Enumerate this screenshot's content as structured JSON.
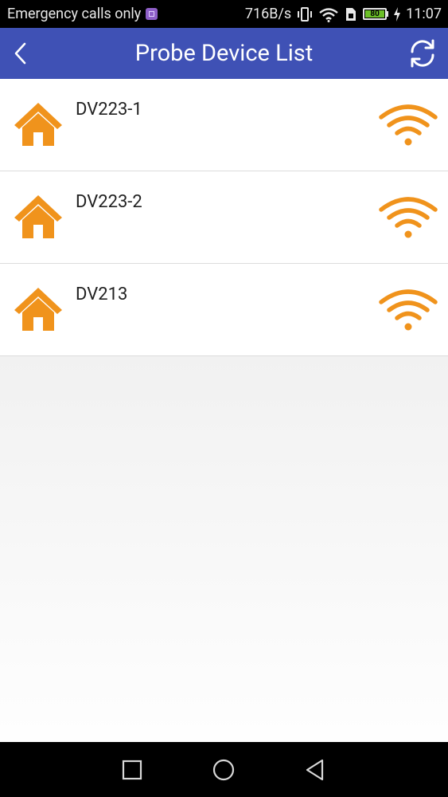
{
  "status_bar": {
    "carrier_text": "Emergency calls only",
    "network_speed": "716B/s",
    "battery_level": "80",
    "time": "11:07"
  },
  "header": {
    "title": "Probe Device List",
    "back_icon": "chevron-left-icon",
    "refresh_icon": "refresh-icon"
  },
  "devices": [
    {
      "name": "DV223-1",
      "icon": "home-icon",
      "signal_icon": "wifi-icon"
    },
    {
      "name": "DV223-2",
      "icon": "home-icon",
      "signal_icon": "wifi-icon"
    },
    {
      "name": "DV213",
      "icon": "home-icon",
      "signal_icon": "wifi-icon"
    }
  ],
  "nav_bar": {
    "buttons": [
      "recents-button",
      "home-button",
      "back-button"
    ]
  },
  "colors": {
    "header_bg": "#3f51b5",
    "accent_orange": "#f0931c",
    "status_bar_bg": "#000000"
  }
}
